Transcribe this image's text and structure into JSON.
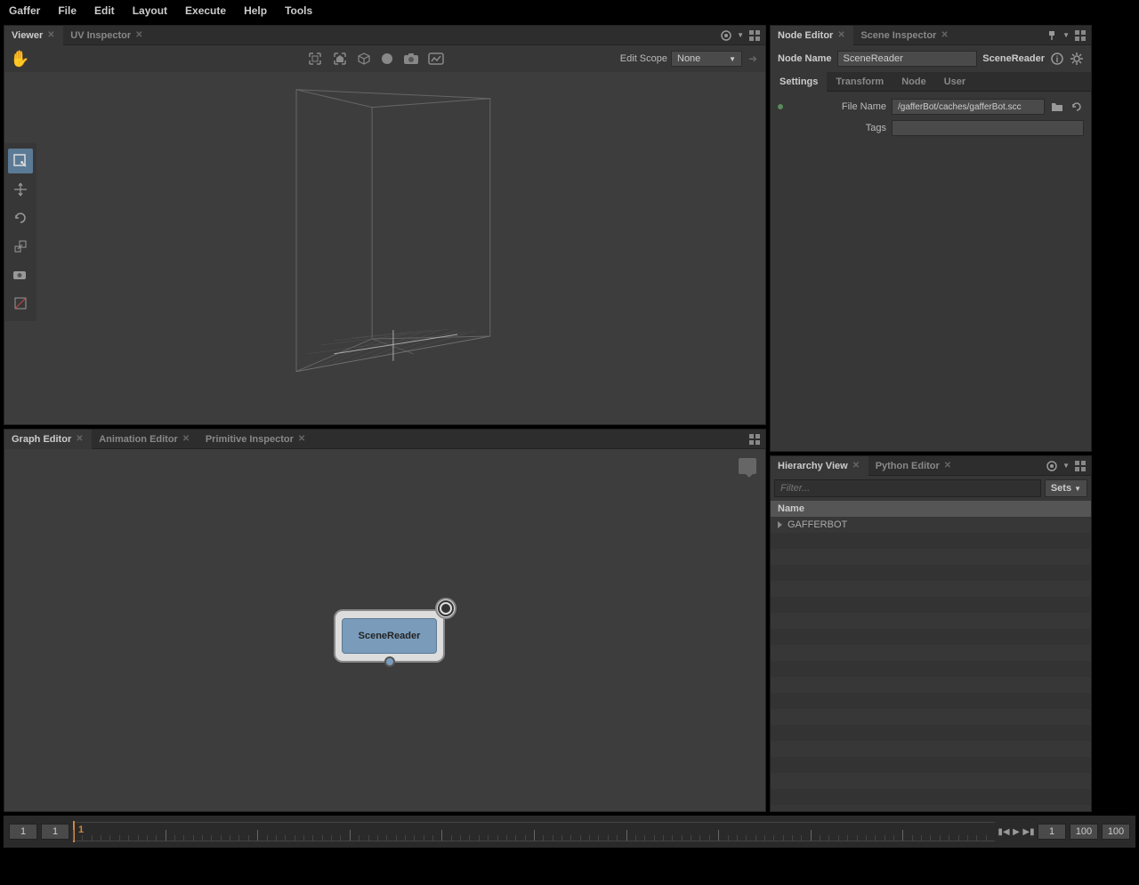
{
  "menubar": [
    "Gaffer",
    "File",
    "Edit",
    "Layout",
    "Execute",
    "Help",
    "Tools"
  ],
  "viewer": {
    "tabs": [
      {
        "label": "Viewer",
        "active": true
      },
      {
        "label": "UV Inspector",
        "active": false
      }
    ],
    "editScopeLabel": "Edit Scope",
    "editScopeValue": "None"
  },
  "graph": {
    "tabs": [
      {
        "label": "Graph Editor",
        "active": true
      },
      {
        "label": "Animation Editor",
        "active": false
      },
      {
        "label": "Primitive Inspector",
        "active": false
      }
    ],
    "nodeLabel": "SceneReader"
  },
  "nodeEditor": {
    "tabs": [
      {
        "label": "Node Editor",
        "active": true
      },
      {
        "label": "Scene Inspector",
        "active": false
      }
    ],
    "nodeNameLabel": "Node Name",
    "nodeNameValue": "SceneReader",
    "nodeType": "SceneReader",
    "subtabs": [
      {
        "label": "Settings",
        "active": true
      },
      {
        "label": "Transform",
        "active": false
      },
      {
        "label": "Node",
        "active": false
      },
      {
        "label": "User",
        "active": false
      }
    ],
    "rows": [
      {
        "label": "File Name",
        "value": "/gafferBot/caches/gafferBot.scc",
        "hasIcons": true
      },
      {
        "label": "Tags",
        "value": "",
        "hasIcons": false
      }
    ]
  },
  "hierarchy": {
    "tabs": [
      {
        "label": "Hierarchy View",
        "active": true
      },
      {
        "label": "Python Editor",
        "active": false
      }
    ],
    "filterPlaceholder": "Filter...",
    "setsLabel": "Sets",
    "headerLabel": "Name",
    "items": [
      {
        "name": "GAFFERBOT"
      }
    ]
  },
  "timeline": {
    "startFrame": "1",
    "startRange": "1",
    "currentFrame": "1",
    "endFrameInput": "1",
    "endRange": "100",
    "endFrame": "100"
  }
}
